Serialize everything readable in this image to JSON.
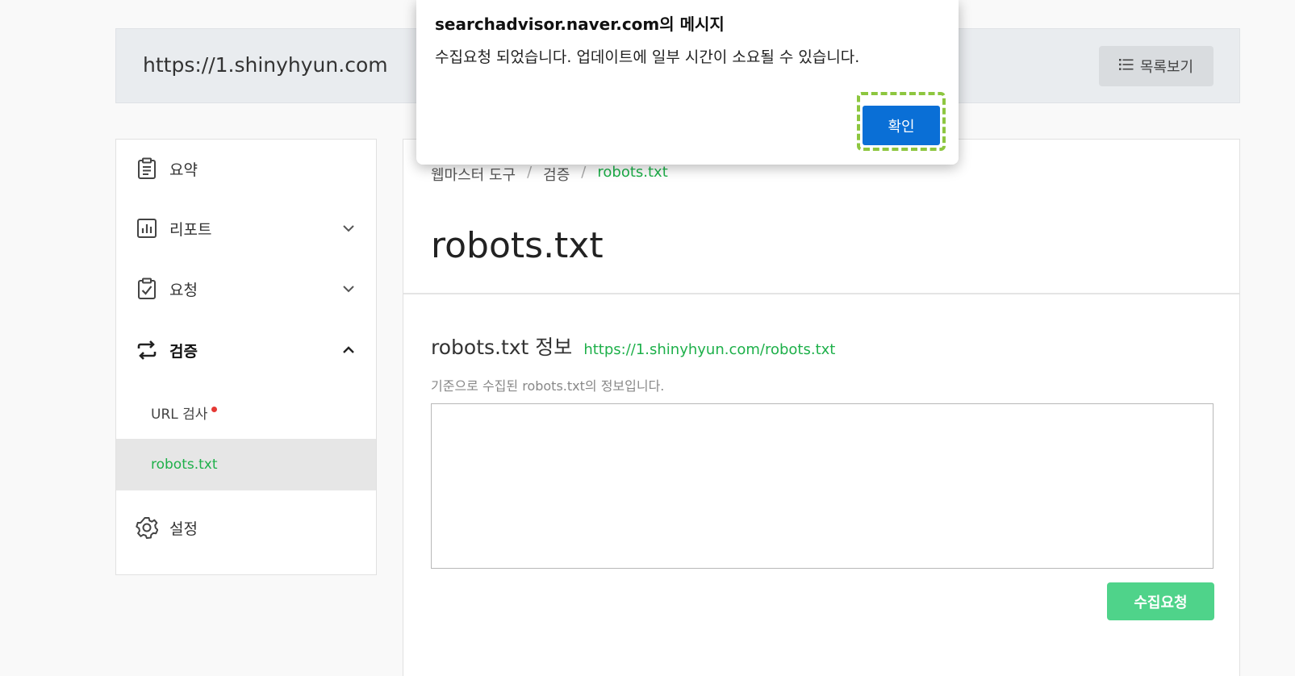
{
  "site": {
    "url": "https://1.shinyhyun.com",
    "list_button_label": "목록보기",
    "list_icon": "list-icon"
  },
  "sidebar": {
    "items": [
      {
        "label": "요약",
        "icon": "clipboard-icon"
      },
      {
        "label": "리포트",
        "icon": "bar-chart-icon",
        "expanded": false
      },
      {
        "label": "요청",
        "icon": "clipboard-check-icon",
        "expanded": false
      },
      {
        "label": "검증",
        "icon": "sync-arrows-icon",
        "expanded": true,
        "active": true
      },
      {
        "label": "설정",
        "icon": "gear-icon"
      }
    ],
    "sub_items": [
      {
        "label": "URL 검사",
        "has_badge": true
      },
      {
        "label": "robots.txt",
        "selected": true
      }
    ]
  },
  "main": {
    "breadcrumb": [
      "웹마스터 도구",
      "검증",
      "robots.txt"
    ],
    "breadcrumb_sep": "/",
    "title": "robots.txt",
    "info_title": "robots.txt 정보",
    "info_link": "https://1.shinyhyun.com/robots.txt",
    "info_desc": "기준으로 수집된 robots.txt의 정보입니다.",
    "robots_content": "",
    "collect_button": "수집요청"
  },
  "dialog": {
    "title": "searchadvisor.naver.com의 메시지",
    "message": "수집요청 되었습니다. 업데이트에 일부 시간이 소요될 수 있습니다.",
    "ok_button": "확인"
  },
  "colors": {
    "accent_green": "#1eb04a",
    "button_green": "#4fd38a",
    "dialog_blue": "#0a6fd6",
    "highlight": "#8dc63f",
    "badge_red": "#e53935"
  }
}
